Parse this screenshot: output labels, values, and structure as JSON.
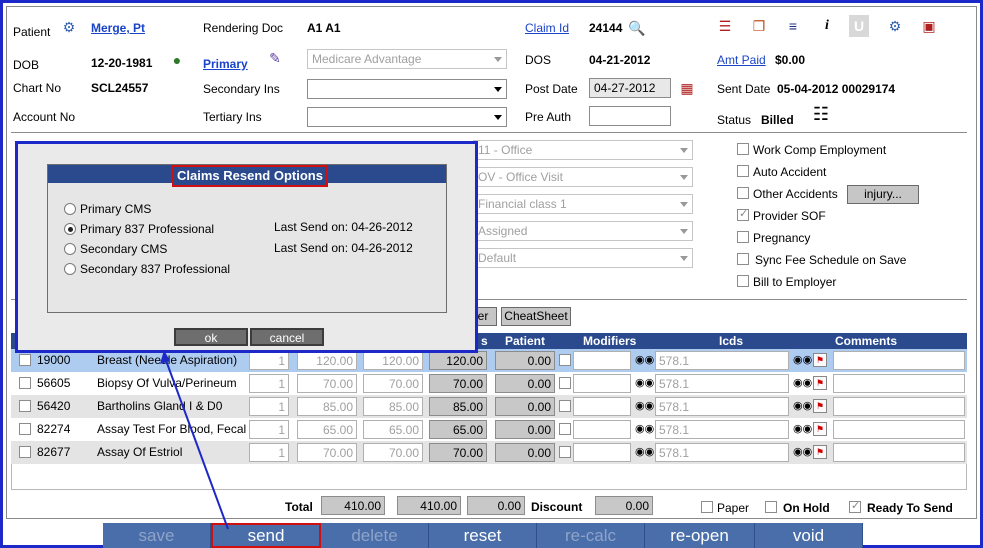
{
  "header": {
    "patient_label": "Patient",
    "patient_name": "Merge, Pt",
    "dob_label": "DOB",
    "dob_value": "12-20-1981",
    "chart_label": "Chart No",
    "chart_value": "SCL24557",
    "account_label": "Account No",
    "rendering_label": "Rendering Doc",
    "rendering_value": "A1 A1",
    "primary_link": "Primary",
    "primary_ins_value": "Medicare Advantage",
    "secondary_label": "Secondary Ins",
    "tertiary_label": "Tertiary Ins",
    "claim_link": "Claim Id",
    "claim_value": "24144",
    "dos_label": "DOS",
    "dos_value": "04-21-2012",
    "post_label": "Post Date",
    "post_value": "04-27-2012",
    "preauth_label": "Pre Auth",
    "amtpaid_link": "Amt Paid",
    "amtpaid_value": "$0.00",
    "sent_label": "Sent Date",
    "sent_value": "05-04-2012 00029174",
    "status_label": "Status",
    "status_value": "Billed"
  },
  "middle": {
    "pos_value": "11 - Office",
    "visit_value": "OV - Office Visit",
    "fin_value": "Financial class 1",
    "assigned_value": "Assigned",
    "default_value": "Default",
    "checks": [
      {
        "label": "Work Comp Employment",
        "checked": false
      },
      {
        "label": "Auto Accident",
        "checked": false
      },
      {
        "label": "Other Accidents",
        "checked": false
      },
      {
        "label": "Provider SOF",
        "checked": true
      },
      {
        "label": "Pregnancy",
        "checked": false
      },
      {
        "label": "Sync Fee Schedule on Save",
        "checked": false
      },
      {
        "label": "Bill to Employer",
        "checked": false
      }
    ],
    "injury_button": "injury...",
    "partial_button": "er",
    "cheatsheet_button": "CheatSheet"
  },
  "grid": {
    "headers": {
      "ins": "s",
      "patient": "Patient",
      "modifiers": "Modifiers",
      "icds": "Icds",
      "comments": "Comments"
    },
    "rows": [
      {
        "code": "19000",
        "desc": "Breast (Needle Aspiration)",
        "units": "1",
        "fee": "120.00",
        "allowed": "120.00",
        "ins": "120.00",
        "patient": "0.00",
        "icd": "578.1"
      },
      {
        "code": "56605",
        "desc": "Biopsy Of Vulva/Perineum",
        "units": "1",
        "fee": "70.00",
        "allowed": "70.00",
        "ins": "70.00",
        "patient": "0.00",
        "icd": "578.1"
      },
      {
        "code": "56420",
        "desc": "Bartholins Gland I & D0",
        "units": "1",
        "fee": "85.00",
        "allowed": "85.00",
        "ins": "85.00",
        "patient": "0.00",
        "icd": "578.1"
      },
      {
        "code": "82274",
        "desc": "Assay Test For Blood, Fecal",
        "units": "1",
        "fee": "65.00",
        "allowed": "65.00",
        "ins": "65.00",
        "patient": "0.00",
        "icd": "578.1"
      },
      {
        "code": "82677",
        "desc": "Assay Of Estriol",
        "units": "1",
        "fee": "70.00",
        "allowed": "70.00",
        "ins": "70.00",
        "patient": "0.00",
        "icd": "578.1"
      }
    ]
  },
  "totals": {
    "total_label": "Total",
    "total1": "410.00",
    "total2": "410.00",
    "patient_total": "0.00",
    "discount_label": "Discount",
    "discount_value": "0.00",
    "paper_label": "Paper",
    "onhold_label": "On Hold",
    "ready_label": "Ready To Send"
  },
  "buttons": {
    "save": "save",
    "send": "send",
    "delete": "delete",
    "reset": "reset",
    "recalc": "re-calc",
    "reopen": "re-open",
    "void": "void"
  },
  "dialog": {
    "title": "Claims Resend Options",
    "options": [
      {
        "label": "Primary CMS",
        "selected": false,
        "last_send": ""
      },
      {
        "label": "Primary 837 Professional",
        "selected": true,
        "last_send": "Last Send on: 04-26-2012"
      },
      {
        "label": "Secondary CMS",
        "selected": false,
        "last_send": "Last Send on: 04-26-2012"
      },
      {
        "label": "Secondary 837 Professional",
        "selected": false,
        "last_send": ""
      }
    ],
    "ok": "ok",
    "cancel": "cancel"
  },
  "colors": {
    "accent_blue": "#1c28c8",
    "header_navy": "#2b4a8e",
    "button_blue": "#4a6eaa",
    "highlight_red": "#d01010"
  }
}
